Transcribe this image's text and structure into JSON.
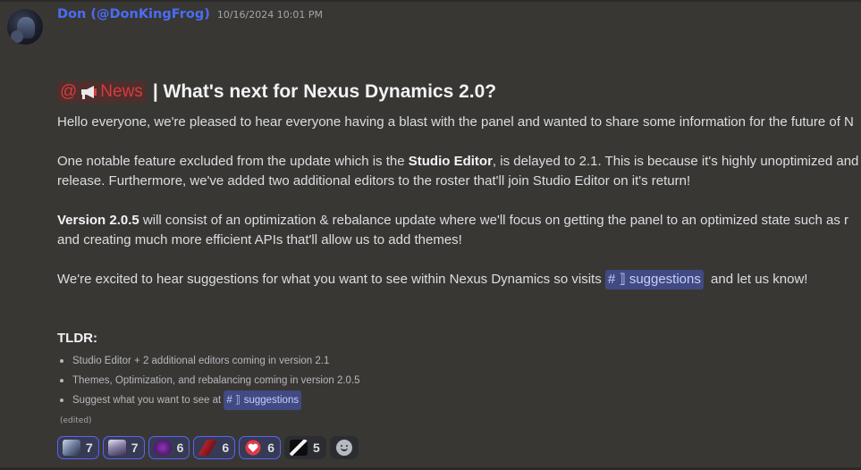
{
  "message": {
    "username": "Don (@DonKingFrog)",
    "timestamp": "10/16/2024 10:01 PM",
    "role_mention": "@",
    "role_name": "News",
    "title": "| What's next for Nexus Dynamics 2.0?",
    "p1": "Hello everyone, we're pleased to hear everyone having a blast with the panel and wanted to share some information for the future of N",
    "p2_pre": "One notable feature excluded from the update which is the ",
    "p2_bold": "Studio Editor",
    "p2_post": ", is delayed to 2.1. This is because it's highly unoptimized and",
    "p2_line2": "release. Furthermore, we've added two additional editors to the roster that'll join Studio Editor on it's return!",
    "p3_bold": "Version 2.0.5",
    "p3_post": " will consist of an optimization & rebalance update where we'll focus on getting the panel to an optimized state such as r",
    "p3_line2": "and creating much more efficient APIs that'll allow us to add themes!",
    "p4_pre": "We're excited to hear suggestions for what you want to see within Nexus Dynamics so visits",
    "p4_post": "and let us know!",
    "channel_icon": "# ⟧",
    "channel_name": "suggestions",
    "tldr": "TLDR:",
    "bullets": [
      "Studio Editor + 2 additional editors coming in version 2.1",
      "Themes, Optimization, and rebalancing coming in version 2.0.5",
      "Suggest what you want to see at"
    ],
    "edited": "(edited)"
  },
  "reactions": [
    {
      "name": "custom-emoji-1",
      "count": "7",
      "me": true,
      "color": "#6b7a9a"
    },
    {
      "name": "custom-emoji-2",
      "count": "7",
      "me": true,
      "color": "#8a7fa8"
    },
    {
      "name": "custom-emoji-3",
      "count": "6",
      "me": true,
      "color": "#6a2a8a"
    },
    {
      "name": "custom-emoji-4",
      "count": "6",
      "me": true,
      "color": "#b0222b"
    },
    {
      "name": "heart-emoji",
      "count": "6",
      "me": true,
      "color": "#e03a4a"
    },
    {
      "name": "custom-emoji-6",
      "count": "5",
      "me": false,
      "color": "#101010"
    }
  ],
  "colors": {
    "background": "#393734",
    "username": "#4a6cf7",
    "role": "#d83c3e",
    "channel_bg": "#414a82",
    "reaction_me_border": "#5865f2"
  }
}
